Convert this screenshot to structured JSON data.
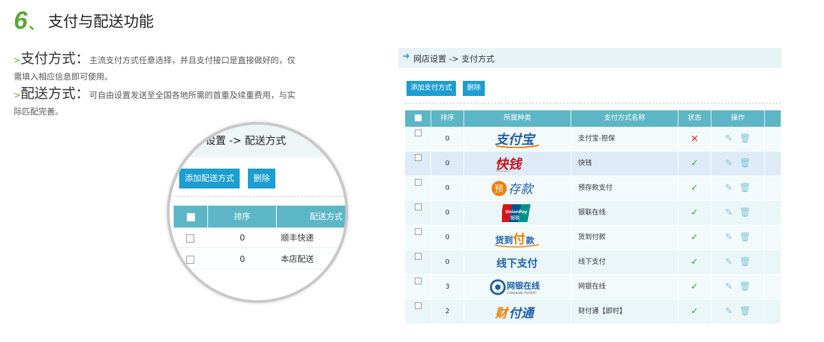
{
  "header": {
    "number": "6",
    "title": "支付与配送功能"
  },
  "description": {
    "payment": {
      "marker": ">",
      "title": "支付方式：",
      "text": "主流支付方式任意选择，并且支付接口是直接做好的，仅需填入相应信息即可使用。"
    },
    "shipping": {
      "marker": ">",
      "title": "配送方式：",
      "text": "可自由设置发送至全国各地所需的首重及续重费用，与实际匹配完善。"
    }
  },
  "zoom": {
    "breadcrumb": "设置 -> 配送方式",
    "buttons": {
      "add": "添加配送方式",
      "delete": "删除"
    },
    "columns": [
      "排序",
      "配送方式"
    ],
    "rows": [
      {
        "order": "0",
        "name": "顺丰快递"
      },
      {
        "order": "0",
        "name": "本店配送"
      }
    ]
  },
  "panel": {
    "breadcrumb": "网店设置 -> 支付方式",
    "buttons": {
      "add": "添加支付方式",
      "delete": "删除"
    },
    "columns": [
      "排序",
      "所属种类",
      "支付方式名称",
      "状态",
      "操作"
    ],
    "rows": [
      {
        "order": "0",
        "logo_text": "支付宝",
        "name": "支付宝-担保",
        "status": "disabled",
        "status_icon": "✕"
      },
      {
        "order": "0",
        "logo_text": "快钱",
        "name": "快钱",
        "status": "enabled",
        "status_icon": "✓"
      },
      {
        "order": "0",
        "logo_text": "预存款",
        "name": "预存款支付",
        "status": "enabled",
        "status_icon": "✓"
      },
      {
        "order": "0",
        "logo_text": "UnionPay 银联",
        "name": "银联在线",
        "status": "enabled",
        "status_icon": "✓"
      },
      {
        "order": "0",
        "logo_text": "货到付款",
        "name": "货到付款",
        "status": "enabled",
        "status_icon": "✓"
      },
      {
        "order": "0",
        "logo_text": "线下支付",
        "name": "线下支付",
        "status": "enabled",
        "status_icon": "✓"
      },
      {
        "order": "3",
        "logo_text": "网银在线",
        "name": "网银在线",
        "status": "enabled",
        "status_icon": "✓"
      },
      {
        "order": "2",
        "logo_text": "财付通",
        "name": "财付通【即时】",
        "status": "enabled",
        "status_icon": "✓"
      }
    ],
    "colors": {
      "accent": "#1c9ed1",
      "header": "#5cb6c5",
      "check": "#2aa12a",
      "cross": "#e03030"
    }
  }
}
